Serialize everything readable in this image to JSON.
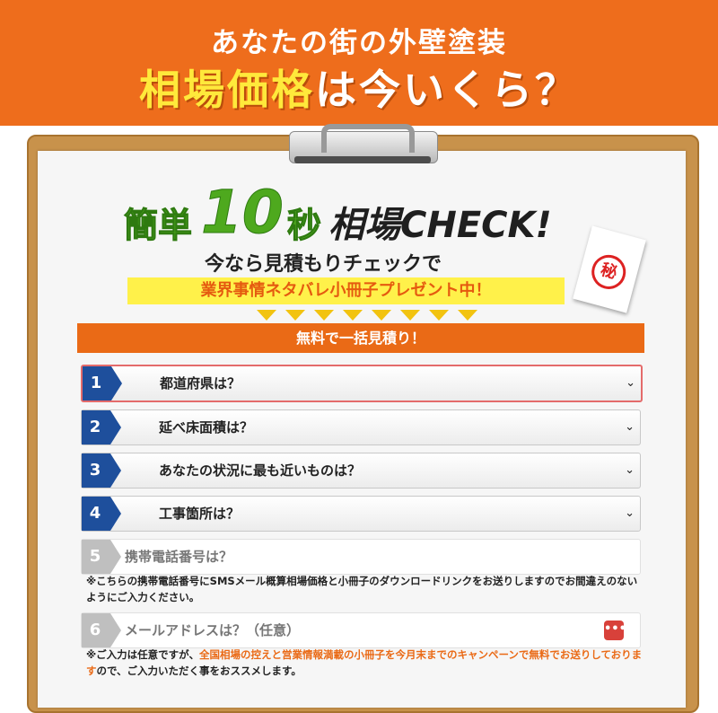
{
  "banner": {
    "subtitle": "あなたの街の外壁塗装",
    "title_highlight": "相場価格",
    "title_rest": "は今いくら？"
  },
  "check": {
    "word1": "簡単",
    "number": "10",
    "word2": "秒",
    "word3": "相場CHECK!",
    "subtitle": "今なら見積もりチェックで",
    "present": "業界事情ネタバレ小冊子プレゼント中！",
    "secret_stamp": "秘",
    "cta_bar": "無料で一括見積り！"
  },
  "form": {
    "steps": [
      {
        "num": "1",
        "label": "都道府県は？"
      },
      {
        "num": "2",
        "label": "延べ床面積は？"
      },
      {
        "num": "3",
        "label": "あなたの状況に最も近いものは？"
      },
      {
        "num": "4",
        "label": "工事箇所は？"
      }
    ],
    "phone": {
      "num": "5",
      "placeholder": "携帯電話番号は？"
    },
    "phone_note": "※こちらの携帯電話番号にSMSメール概算相場価格と小冊子のダウンロードリンクをお送りしますのでお間違えのないようにご入力ください。",
    "email": {
      "num": "6",
      "placeholder": "メールアドレスは？（任意）"
    },
    "email_note_1": "※ご入力は任意ですが、",
    "email_note_2": "全国相場の控えと営業情報満載の小冊子を今月末までのキャンペーンで無料でお送りしております",
    "email_note_3": "ので、ご入力いただく事をおススメします。",
    "chevron": "⌄"
  },
  "colors": {
    "orange": "#ee6d1c",
    "yellow": "#ffe93b",
    "green": "#4ea91e",
    "blue": "#1e4f9c"
  }
}
